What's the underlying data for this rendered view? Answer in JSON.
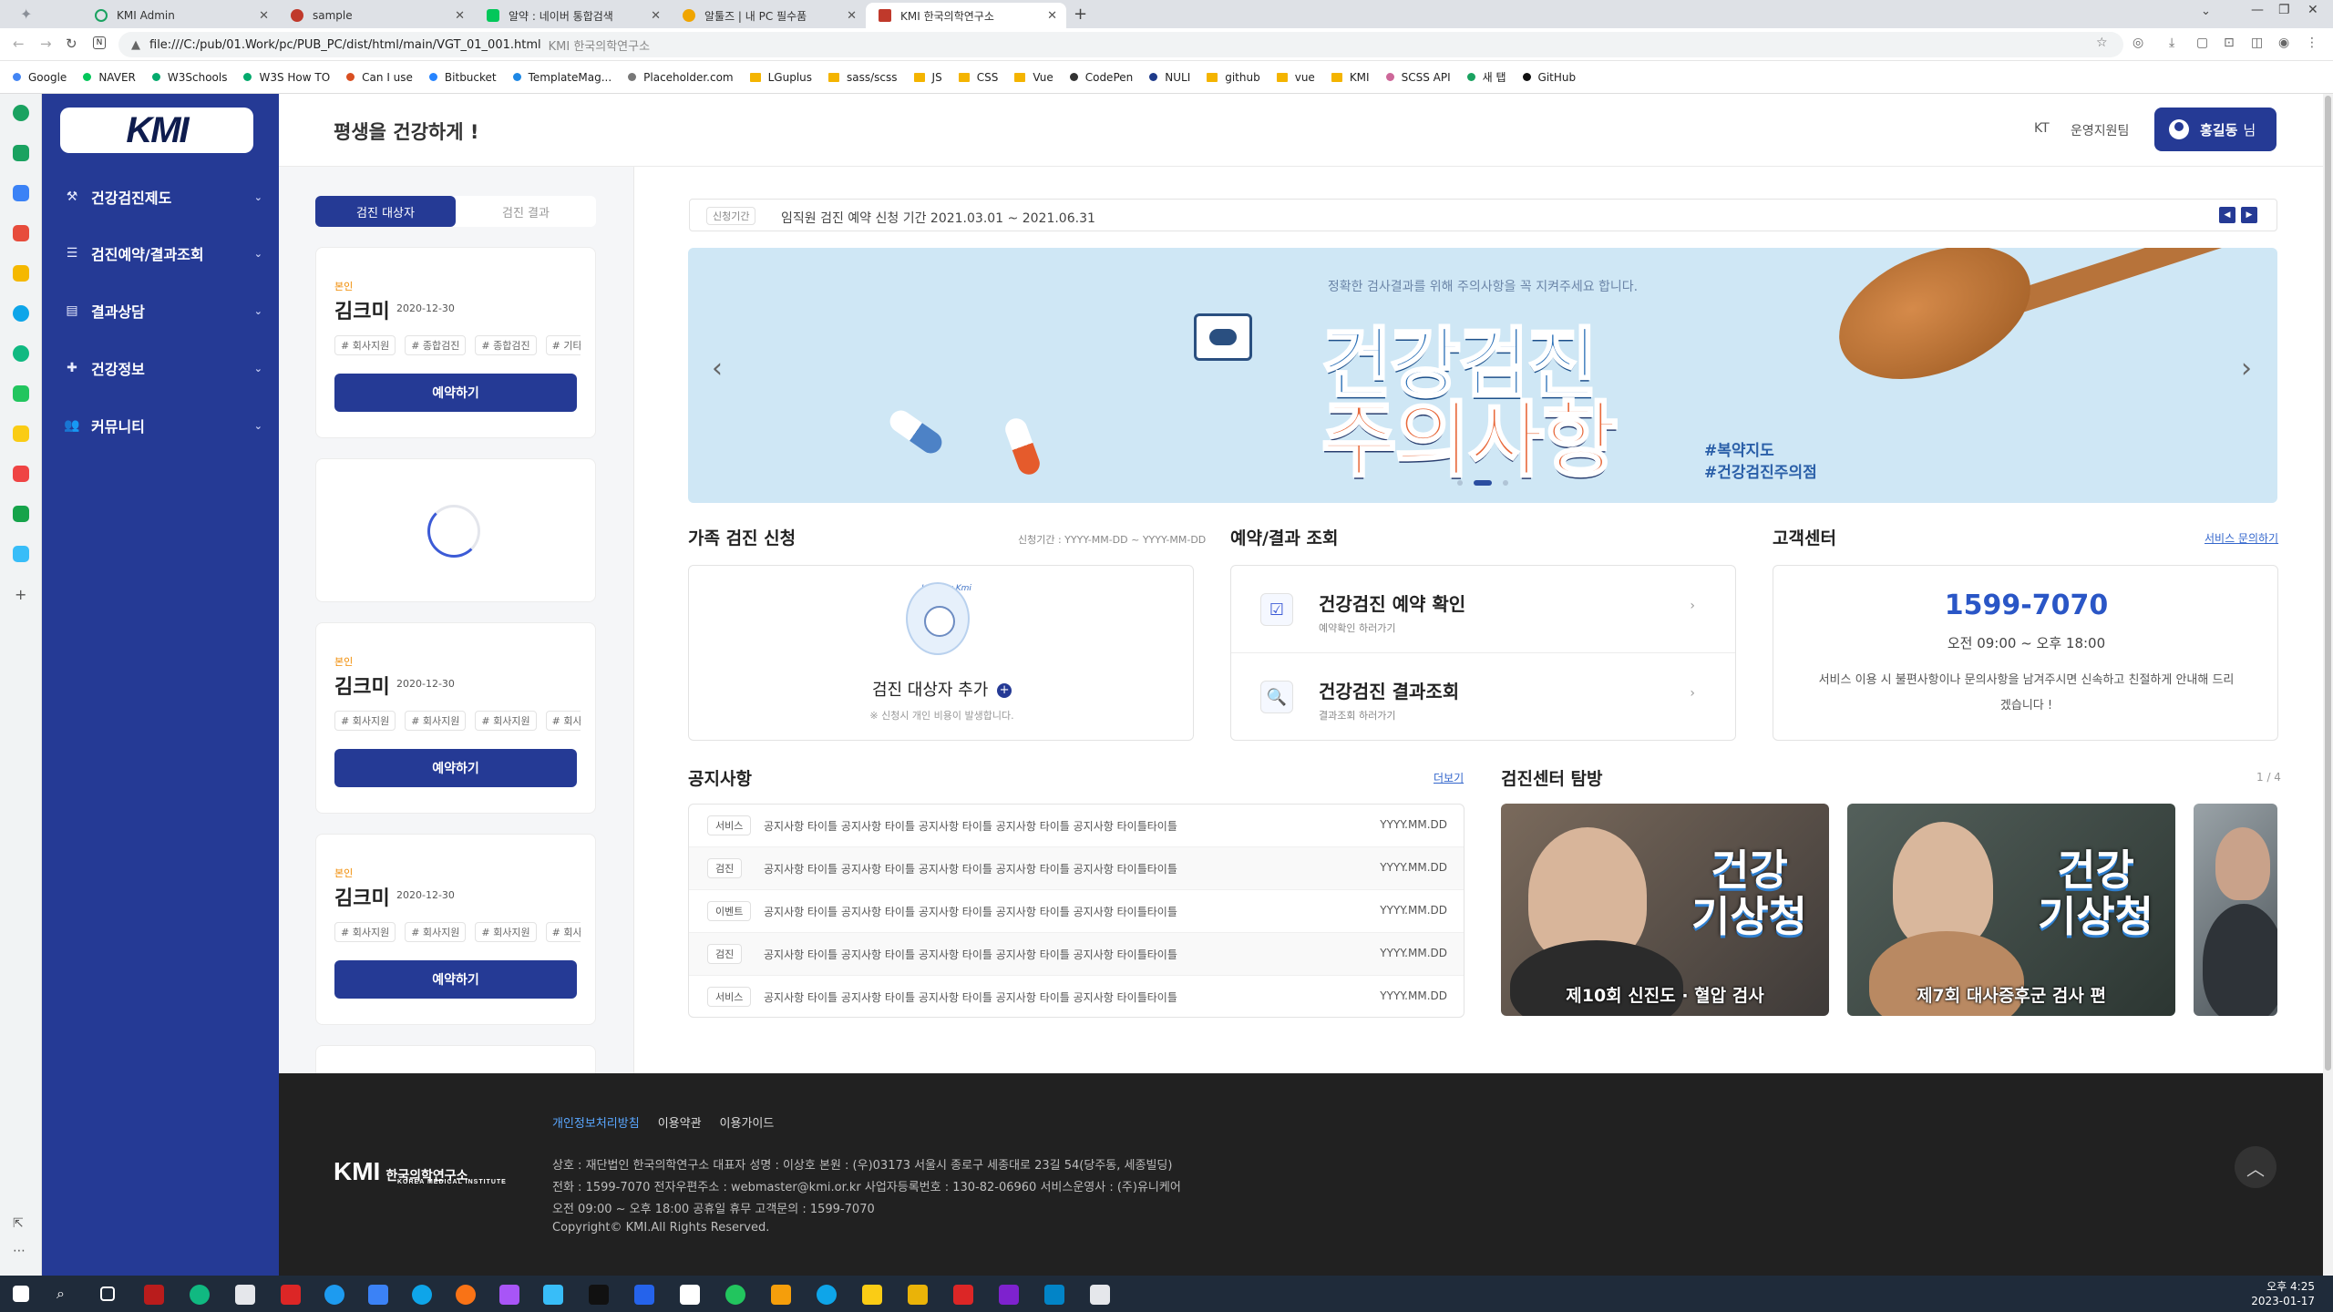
{
  "browser": {
    "tabs": [
      {
        "label": "KMI Admin",
        "color": "#1aa260"
      },
      {
        "label": "sample",
        "color": "#c0392b"
      },
      {
        "label": "알약 : 네이버 통합검색",
        "color": "#03c75a"
      },
      {
        "label": "알툴즈 | 내 PC 필수품",
        "color": "#f0a500"
      },
      {
        "label": "KMI 한국의학연구소",
        "color": "#c0392b"
      }
    ],
    "new_tab": "+",
    "url": "file:///C:/pub/01.Work/pc/PUB_PC/dist/html/main/VGT_01_001.html",
    "url_title": "KMI 한국의학연구소",
    "bookmarks": [
      {
        "label": "Google",
        "type": "dot",
        "color": "#4285f4"
      },
      {
        "label": "NAVER",
        "type": "dot",
        "color": "#03c75a"
      },
      {
        "label": "W3Schools",
        "type": "dot",
        "color": "#04aa6d"
      },
      {
        "label": "W3S How TO",
        "type": "dot",
        "color": "#04aa6d"
      },
      {
        "label": "Can I use",
        "type": "dot",
        "color": "#d94f21"
      },
      {
        "label": "Bitbucket",
        "type": "dot",
        "color": "#2684ff"
      },
      {
        "label": "TemplateMag...",
        "type": "dot",
        "color": "#1e88e5"
      },
      {
        "label": "Placeholder.com",
        "type": "dot",
        "color": "#777777"
      },
      {
        "label": "LGuplus",
        "type": "folder"
      },
      {
        "label": "sass/scss",
        "type": "folder"
      },
      {
        "label": "JS",
        "type": "folder"
      },
      {
        "label": "CSS",
        "type": "folder"
      },
      {
        "label": "Vue",
        "type": "folder"
      },
      {
        "label": "CodePen",
        "type": "dot",
        "color": "#333333"
      },
      {
        "label": "NULI",
        "type": "dot",
        "color": "#1e3a8a"
      },
      {
        "label": "github",
        "type": "folder"
      },
      {
        "label": "vue",
        "type": "folder"
      },
      {
        "label": "KMI",
        "type": "folder"
      },
      {
        "label": "SCSS API",
        "type": "dot",
        "color": "#cd6799"
      },
      {
        "label": "새 탭",
        "type": "dot",
        "color": "#1aa260"
      },
      {
        "label": "GitHub",
        "type": "dot",
        "color": "#111111"
      }
    ]
  },
  "site": {
    "logo": "KMI",
    "slogan": "평생을 건강하게 !",
    "header_links": {
      "kt": "KT",
      "ops": "운영지원팀"
    },
    "user": {
      "name": "홍길동",
      "suffix": "님"
    },
    "nav": [
      {
        "label": "건강검진제도",
        "icon": "hammer-icon"
      },
      {
        "label": "검진예약/결과조회",
        "icon": "checklist-icon"
      },
      {
        "label": "결과상담",
        "icon": "clipboard-icon"
      },
      {
        "label": "건강정보",
        "icon": "medical-bag-icon"
      },
      {
        "label": "커뮤니티",
        "icon": "people-icon"
      }
    ]
  },
  "panel": {
    "tabs": [
      "검진 대상자",
      "검진 결과"
    ],
    "cards": [
      {
        "relation": "본인",
        "name": "김크미",
        "date": "2020-12-30",
        "tags": [
          "# 회사지원",
          "# 종합검진",
          "# 종합검진",
          "# 기타"
        ],
        "button": "예약하기"
      },
      {
        "relation": "본인",
        "name": "김크미",
        "date": "2020-12-30",
        "tags": [
          "# 회사지원",
          "# 회사지원",
          "# 회사지원",
          "# 회사지원"
        ],
        "button": "예약하기"
      },
      {
        "relation": "본인",
        "name": "김크미",
        "date": "2020-12-30",
        "tags": [
          "# 회사지원",
          "# 회사지원",
          "# 회사지원",
          "# 회사지원"
        ],
        "button": "예약하기"
      }
    ]
  },
  "notice_bar": {
    "label": "신청기간",
    "text": "임직원 검진 예약 신청 기간 2021.03.01 ~ 2021.06.31"
  },
  "banner": {
    "top_text": "정확한 검사결과를 위해 주의사항을 꼭 지켜주세요 합니다.",
    "title_line1": "건강검진",
    "title_line2": "주의사항",
    "tag1": "#복약지도",
    "tag2": "#건강검진주의점",
    "active_slide": 2,
    "slide_count": 3
  },
  "family": {
    "title": "가족 검진 신청",
    "period": "신청기간 : YYYY-MM-DD ~ YYYY-MM-DD",
    "mascot_text": "Healthy Kmi",
    "add_label": "검진 대상자 추가",
    "note": "※ 신청시 개인 비용이 발생합니다."
  },
  "reservation": {
    "title": "예약/결과 조회",
    "items": [
      {
        "title": "건강검진 예약 확인",
        "sub": "예약확인 하러가기",
        "icon": "calendar-check-icon"
      },
      {
        "title": "건강검진 결과조회",
        "sub": "결과조회 하러가기",
        "icon": "report-search-icon"
      }
    ]
  },
  "customer": {
    "title": "고객센터",
    "link": "서비스 문의하기",
    "phone": "1599-7070",
    "hours": "오전 09:00 ~ 오후 18:00",
    "desc1": "서비스 이용 시 불편사항이나 문의사항을 남겨주시면 신속하고 친절하게 안내해 드리",
    "desc2": "겠습니다 !"
  },
  "notices": {
    "title": "공지사항",
    "more": "더보기",
    "rows": [
      {
        "cat": "서비스",
        "title": "공지사항 타이틀 공지사항 타이틀 공지사항 타이틀 공지사항 타이틀 공지사항 타이틀타이틀",
        "date": "YYYY.MM.DD"
      },
      {
        "cat": "검진",
        "title": "공지사항 타이틀 공지사항 타이틀 공지사항 타이틀 공지사항 타이틀 공지사항 타이틀타이틀",
        "date": "YYYY.MM.DD"
      },
      {
        "cat": "이벤트",
        "title": "공지사항 타이틀 공지사항 타이틀 공지사항 타이틀 공지사항 타이틀 공지사항 타이틀타이틀",
        "date": "YYYY.MM.DD"
      },
      {
        "cat": "검진",
        "title": "공지사항 타이틀 공지사항 타이틀 공지사항 타이틀 공지사항 타이틀 공지사항 타이틀타이틀",
        "date": "YYYY.MM.DD"
      },
      {
        "cat": "서비스",
        "title": "공지사항 타이틀 공지사항 타이틀 공지사항 타이틀 공지사항 타이틀 공지사항 타이틀타이틀",
        "date": "YYYY.MM.DD"
      }
    ]
  },
  "center_tour": {
    "title": "검진센터 탐방",
    "pager": "1 / 4",
    "videos": [
      {
        "title_a": "건강",
        "title_b": "기상청",
        "caption": "제10회 신진도 · 혈압 검사"
      },
      {
        "title_a": "건강",
        "title_b": "기상청",
        "caption": "제7회 대사증후군 검사 편"
      }
    ]
  },
  "footer": {
    "logo": "KMI",
    "logo_kr": "한국의학연구소",
    "logo_en": "KOREA MEDICAL INSTITUTE",
    "links": [
      "개인정보처리방침",
      "이용약관",
      "이용가이드"
    ],
    "line1": "상호 : 재단법인 한국의학연구소   대표자 성명 : 이상호   본원 : (우)03173 서울시 종로구 세종대로 23길 54(당주동, 세종빌딩)",
    "line2": "전화 : 1599-7070   전자우편주소 : webmaster@kmi.or.kr   사업자등록번호 : 130-82-06960   서비스운영사 : (주)유니케어",
    "line3": "오전 09:00 ~ 오후 18:00  공휴일 휴무  고객문의 : 1599-7070",
    "copyright": "Copyright© KMI.All Rights Reserved."
  },
  "taskbar": {
    "time": "오후 4:25",
    "date": "2023-01-17"
  }
}
